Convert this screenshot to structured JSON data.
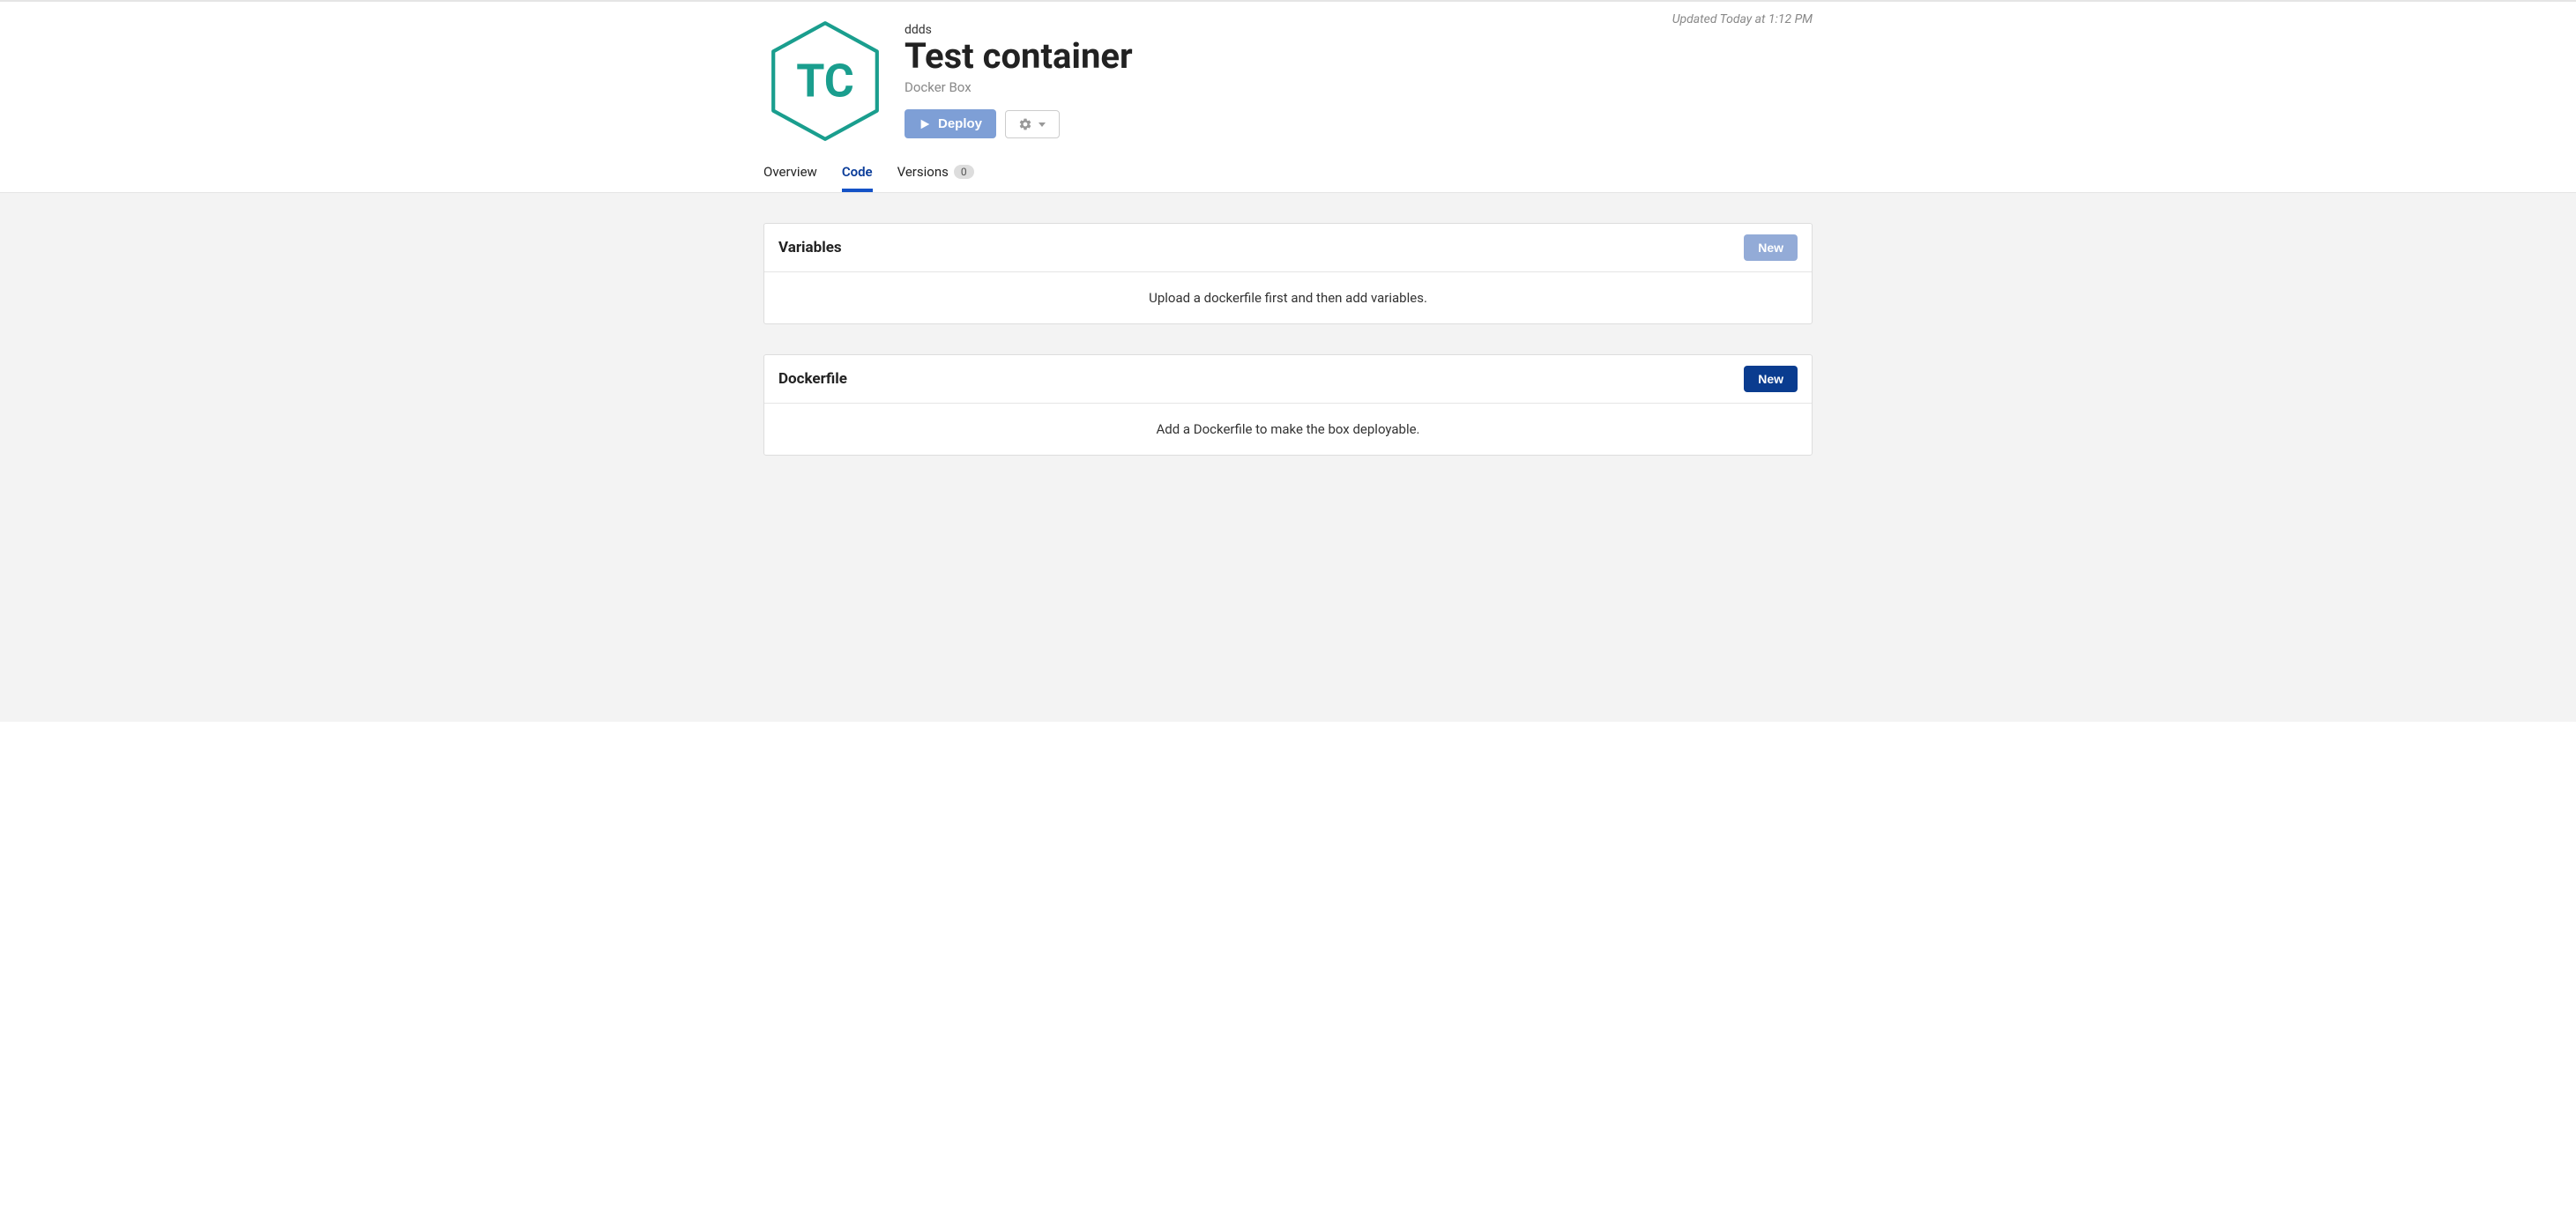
{
  "header": {
    "breadcrumb": "ddds",
    "title": "Test container",
    "subtitle": "Docker Box",
    "icon_initials": "TC",
    "deploy_label": "Deploy",
    "updated_text": "Updated Today at 1:12 PM"
  },
  "tabs": {
    "overview": "Overview",
    "code": "Code",
    "versions": "Versions",
    "versions_count": "0"
  },
  "panels": {
    "variables": {
      "title": "Variables",
      "new_label": "New",
      "body": "Upload a dockerfile first and then add variables."
    },
    "dockerfile": {
      "title": "Dockerfile",
      "new_label": "New",
      "body": "Add a Dockerfile to make the box deployable."
    }
  }
}
